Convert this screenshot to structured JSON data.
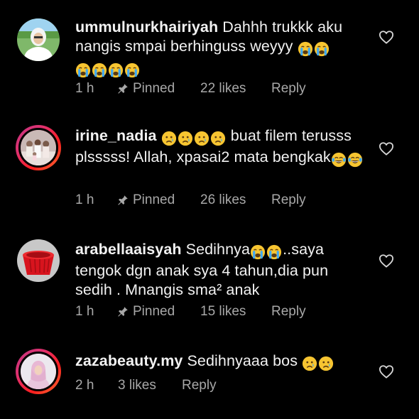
{
  "comments": [
    {
      "username": "ummulnurkhairiyah",
      "text_before": "Dahhh trukkk aku nangis smpai berhinguss weyyy",
      "emoji_after": [
        "loudly-crying-face",
        "loudly-crying-face",
        "loudly-crying-face",
        "loudly-crying-face",
        "loudly-crying-face",
        "loudly-crying-face"
      ],
      "time": "1 h",
      "pinned_label": "Pinned",
      "likes": "22 likes",
      "reply_label": "Reply"
    },
    {
      "username": "irine_nadia",
      "emoji_before": [
        "crying-face",
        "crying-face",
        "crying-face",
        "crying-face"
      ],
      "text": "buat filem terusss plsssss! Allah,  xpasai2 mata bengkak",
      "emoji_after": [
        "tears-of-joy-face",
        "tears-of-joy-face"
      ],
      "time": "1 h",
      "pinned_label": "Pinned",
      "likes": "26 likes",
      "reply_label": "Reply"
    },
    {
      "username": "arabellaaisyah",
      "text_a": "Sedihnya",
      "emoji_mid": [
        "loudly-crying-face",
        "loudly-crying-face"
      ],
      "text_b": "..saya tengok dgn anak sya 4 tahun,dia pun sedih . Mnangis sma² anak",
      "time": "1 h",
      "pinned_label": "Pinned",
      "likes": "15 likes",
      "reply_label": "Reply"
    },
    {
      "username": "zazabeauty.my",
      "text": "Sedihnyaaa bos",
      "emoji_after": [
        "crying-face",
        "crying-face"
      ],
      "time": "2 h",
      "likes": "3 likes",
      "reply_label": "Reply"
    }
  ],
  "colors": {
    "background": "#000000",
    "text": "#f2f2f2",
    "meta": "#a8a8a8",
    "story_ring": "#e1306c"
  },
  "icons": {
    "like": "heart-outline-icon",
    "pin": "pin-icon"
  }
}
